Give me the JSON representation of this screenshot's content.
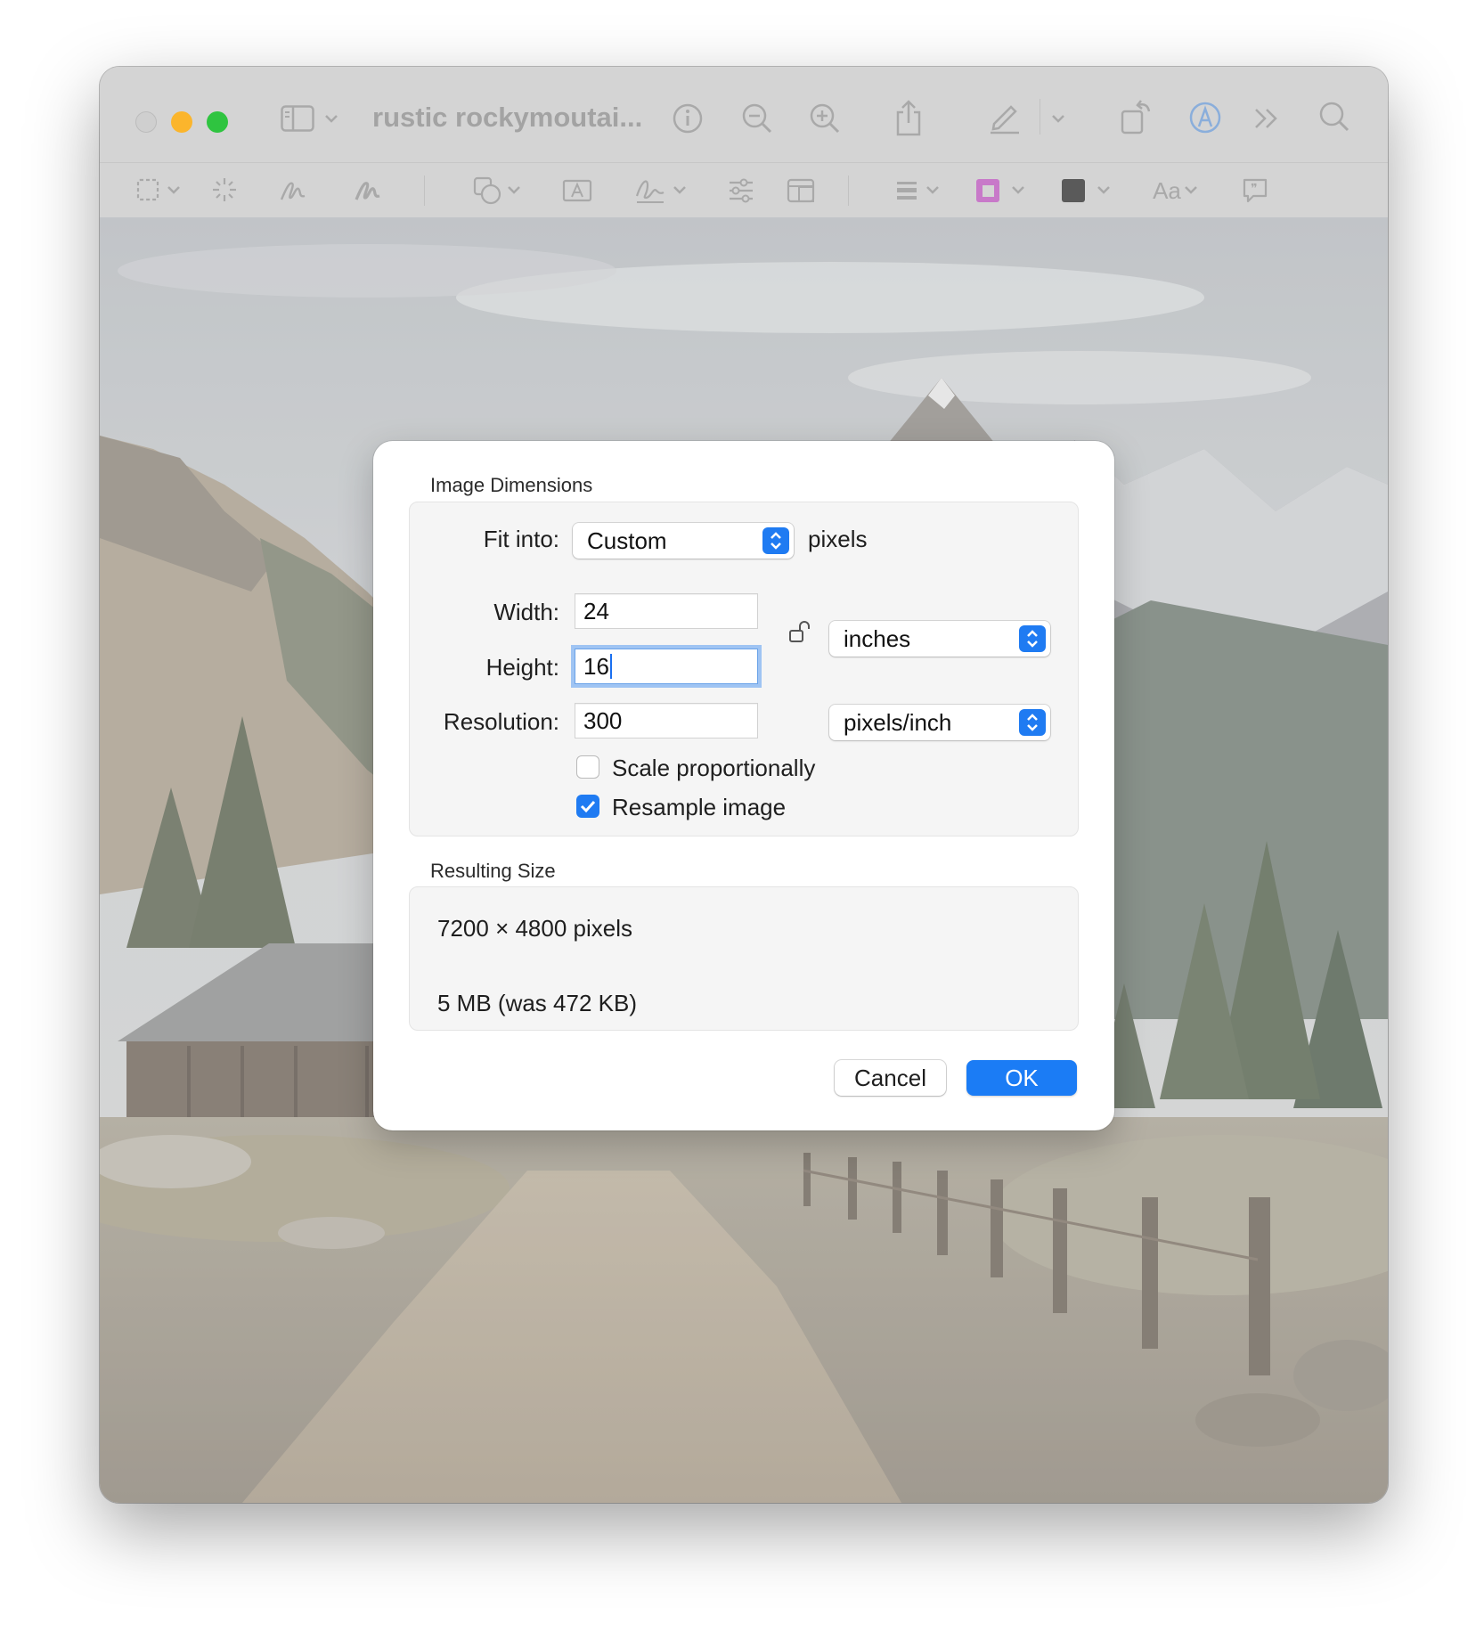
{
  "window": {
    "title": "rustic rockymoutai..."
  },
  "toolbar": {
    "top_icons": [
      "sidebar-icon",
      "chevron-down-icon",
      "info-icon",
      "zoom-out-icon",
      "zoom-in-icon",
      "share-icon",
      "markup-pen-icon",
      "chevron-down-icon",
      "rotate-icon",
      "markup-toolbar-icon",
      "more-icon",
      "search-icon"
    ],
    "markup_icons": [
      "selection-icon",
      "instant-alpha-icon",
      "sketch-icon",
      "draw-icon",
      "shapes-icon",
      "text-icon",
      "sign-icon",
      "adjust-color-icon",
      "adjust-size-icon",
      "line-style-icon",
      "border-color-icon",
      "fill-color-icon",
      "text-style-icon",
      "note-icon"
    ],
    "text_style_label": "Aa"
  },
  "colors": {
    "accent": "#1b7cf5",
    "close": "#c9c9c9",
    "minimize": "#fcb62a",
    "zoom": "#2ec33f",
    "border_swatch": "#c879c9",
    "fill_swatch": "#5a5a5a"
  },
  "dialog": {
    "dimensions_title": "Image Dimensions",
    "fit_into_label": "Fit into:",
    "fit_into_value": "Custom",
    "fit_into_unit": "pixels",
    "width_label": "Width:",
    "width_value": "24",
    "height_label": "Height:",
    "height_value": "16",
    "resolution_label": "Resolution:",
    "resolution_value": "300",
    "size_unit": "inches",
    "resolution_unit": "pixels/inch",
    "scale_label": "Scale proportionally",
    "scale_checked": false,
    "resample_label": "Resample image",
    "resample_checked": true,
    "resulting_title": "Resulting Size",
    "resulting_pixels": "7200 × 4800 pixels",
    "resulting_bytes": "5 MB (was 472 KB)",
    "cancel_label": "Cancel",
    "ok_label": "OK"
  }
}
